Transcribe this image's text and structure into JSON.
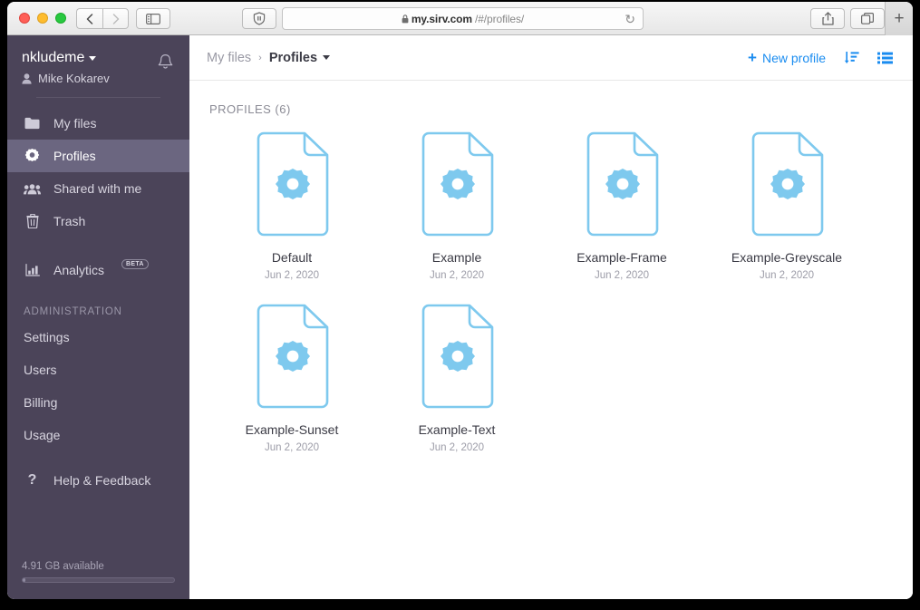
{
  "browser": {
    "url_lock": "lock-icon",
    "url_host": "my.sirv.com",
    "url_path": "/#/profiles/",
    "reload_glyph": "↻",
    "plus_tab": "+"
  },
  "sidebar": {
    "account_name": "nkludeme",
    "user_name": "Mike Kokarev",
    "nav": [
      {
        "label": "My files",
        "icon": "folder-icon",
        "active": false
      },
      {
        "label": "Profiles",
        "icon": "gear-icon",
        "active": true
      },
      {
        "label": "Shared with me",
        "icon": "people-icon",
        "active": false
      },
      {
        "label": "Trash",
        "icon": "trash-icon",
        "active": false
      }
    ],
    "analytics": {
      "label": "Analytics",
      "badge": "BETA",
      "icon": "bar-chart-icon"
    },
    "admin_heading": "ADMINISTRATION",
    "admin_items": [
      {
        "label": "Settings"
      },
      {
        "label": "Users"
      },
      {
        "label": "Billing"
      },
      {
        "label": "Usage"
      }
    ],
    "help": {
      "label": "Help & Feedback",
      "icon": "question-icon"
    },
    "storage": {
      "label": "4.91 GB available",
      "fill_percent": 2
    }
  },
  "main": {
    "breadcrumb": {
      "root": "My files",
      "separator": "›",
      "current": "Profiles"
    },
    "new_profile_label": "New profile",
    "new_profile_plus": "+",
    "sort_icon": "sort-descending-icon",
    "view_icon": "list-view-icon",
    "section_title": "PROFILES (6)",
    "profiles": [
      {
        "name": "Default",
        "date": "Jun 2, 2020"
      },
      {
        "name": "Example",
        "date": "Jun 2, 2020"
      },
      {
        "name": "Example-Frame",
        "date": "Jun 2, 2020"
      },
      {
        "name": "Example-Greyscale",
        "date": "Jun 2, 2020"
      },
      {
        "name": "Example-Sunset",
        "date": "Jun 2, 2020"
      },
      {
        "name": "Example-Text",
        "date": "Jun 2, 2020"
      }
    ]
  },
  "colors": {
    "sidebar_bg": "#4b4459",
    "sidebar_active": "#6b6680",
    "accent_blue": "#1a8cf0",
    "card_blue": "#7ec9ee"
  }
}
